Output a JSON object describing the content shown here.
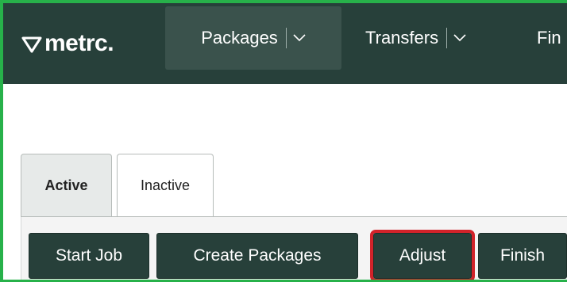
{
  "brand": {
    "name": "metrc."
  },
  "nav": {
    "items": [
      {
        "label": "Packages"
      },
      {
        "label": "Transfers"
      },
      {
        "label": "Fin"
      }
    ]
  },
  "tabs": [
    {
      "label": "Active"
    },
    {
      "label": "Inactive"
    }
  ],
  "actions": {
    "start_job": "Start Job",
    "create_packages": "Create Packages",
    "adjust": "Adjust",
    "finish": "Finish"
  },
  "colors": {
    "nav_bg": "#27403a",
    "frame_border": "#27b14a",
    "highlight": "#d2232a"
  }
}
